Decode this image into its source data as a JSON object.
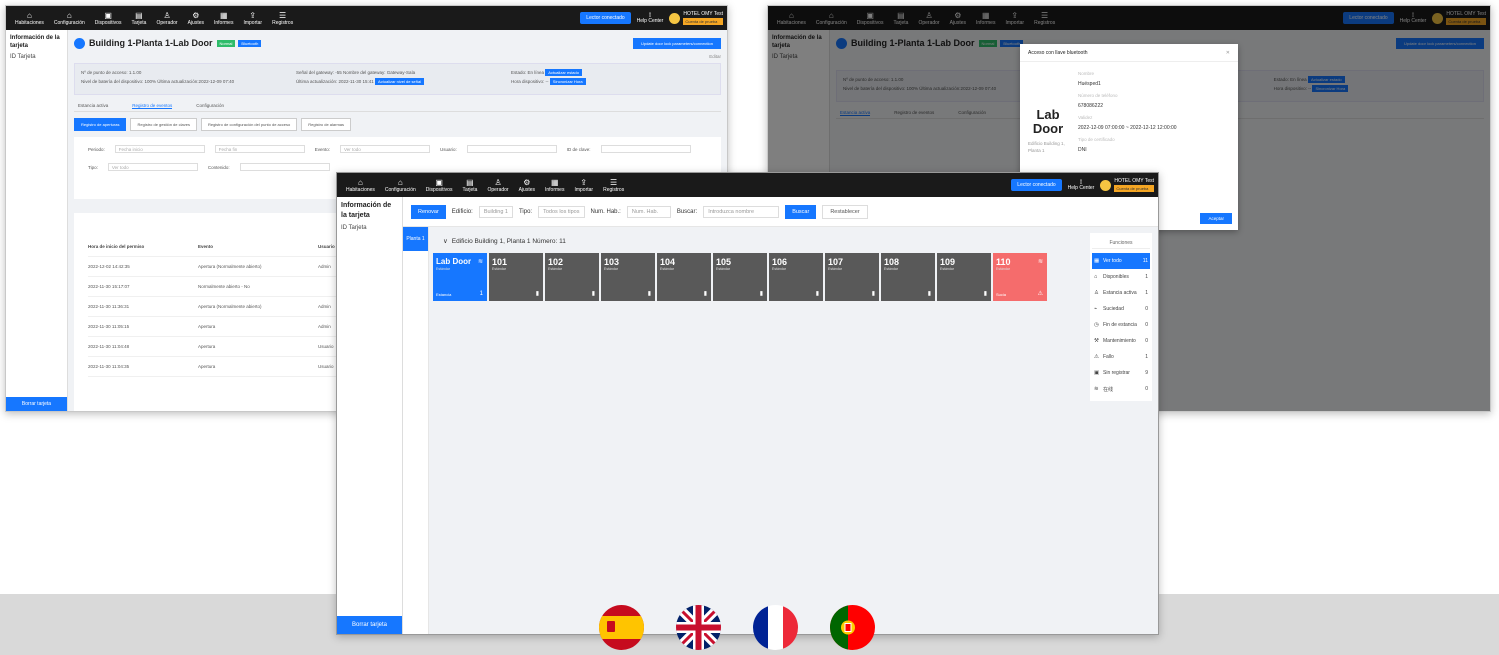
{
  "nav": [
    {
      "icon": "hotel-icon",
      "label": "Habitaciones"
    },
    {
      "icon": "home-icon",
      "label": "Configuración"
    },
    {
      "icon": "device-icon",
      "label": "Dispositivos"
    },
    {
      "icon": "card-icon",
      "label": "Tarjeta"
    },
    {
      "icon": "operator-icon",
      "label": "Operador"
    },
    {
      "icon": "gear-icon",
      "label": "Ajustes"
    },
    {
      "icon": "report-icon",
      "label": "Informes"
    },
    {
      "icon": "import-icon",
      "label": "Importar"
    },
    {
      "icon": "log-icon",
      "label": "Registros"
    }
  ],
  "topbar": {
    "encoder_button": "Lector conectado",
    "help": "Help Center",
    "hotel_name": "HOTEL OMY Test",
    "hotel_tag": "Cuenta de prueba"
  },
  "sidebar": {
    "title": "Información de la tarjeta",
    "item": "ID Tarjeta",
    "bottom_button": "Borrar tarjeta"
  },
  "door_window": {
    "title": "Building 1-Planta 1-Lab Door",
    "tag_status": "Normal",
    "tag_type": "Bluetooth",
    "right_button": "Update door lock parameters/connection",
    "edit": "Editar",
    "info_col1": [
      "Nº de punto de acceso: 1.1.00",
      "Nivel de batería del dispositivo: 100%   Última actualización:2022-12-09 07:40"
    ],
    "info_col2": [
      "Señal del gateway: -55   Nombre del gateway: Gateway-Sala",
      "Última actualización: 2022-11-30 15:41"
    ],
    "info_col2_btn": "Actualizar nivel de señal",
    "info_col3": [
      "Estado: En línea",
      "Hora dispositivo: --"
    ],
    "info_col3_btn1": "Actualizar estado",
    "info_col3_btn2": "Sincronizar Hora",
    "tabs": [
      "Estancia activa",
      "Registro de eventos",
      "Configuración"
    ],
    "sub_tabs": [
      "Registro de aperturas",
      "Registro de gestión de claves",
      "Registro de configuración del punto de acceso",
      "Registro de alarmas"
    ],
    "filter_labels": [
      "Periodo:",
      "Evento:",
      "Usuario:",
      "ID de clave:",
      "Tipo:",
      "Contenido:"
    ],
    "filter_placeholders": [
      "Fecha inicio",
      "Fecha fin",
      "Ver todo",
      "Ver todo"
    ],
    "table_headers": [
      "Hora de inicio del permiso",
      "Evento",
      "Usuario"
    ],
    "table_rows": [
      [
        "2022-12-02 14:42:35",
        "Apertura (Normalmente abierto)",
        "Admin"
      ],
      [
        "2022-11-30 15:17:07",
        "Normalmente abierto - No",
        ""
      ],
      [
        "2022-11-30 11:36:31",
        "Apertura (Normalmente abierto)",
        "Admin"
      ],
      [
        "2022-11-30 11:05:15",
        "Apertura",
        "Admin"
      ],
      [
        "2022-11-30 11:04:48",
        "Apertura",
        "Usuario"
      ],
      [
        "2022-11-30 11:04:35",
        "Apertura",
        "Usuario"
      ]
    ]
  },
  "modal": {
    "title": "Acceso con llave bluetooth",
    "door_name_1": "Lab",
    "door_name_2": "Door",
    "door_sub": "Edificio Building 1, Planta 1",
    "fields": [
      {
        "label": "Nombre",
        "value": "Huésped1"
      },
      {
        "label": "Número de teléfono",
        "value": "678086222"
      },
      {
        "label": "Validez",
        "value": "2022-12-09 07:00:00 ~ 2022-12-12 12:00:00"
      },
      {
        "label": "Tipo de certificado",
        "value": "DNI"
      }
    ],
    "ok": "Aceptar"
  },
  "rooms_window": {
    "toolbar": {
      "refresh": "Renovar",
      "building_label": "Edificio:",
      "building_value": "Building 1",
      "type_label": "Tipo:",
      "type_value": "Todos los tipos",
      "room_label": "Num. Hab.:",
      "room_placeholder": "Num. Hab.",
      "search_label": "Buscar:",
      "search_placeholder": "Introduzca nombre",
      "search_btn": "Buscar",
      "reset_btn": "Restablecer"
    },
    "floor": "Planta 1",
    "building_line": "Edificio Building 1, Planta 1   Número: 11",
    "rooms": [
      {
        "num": "Lab Door",
        "sub": "Estándar",
        "style": "blue",
        "bottom": "Estancia",
        "count": "1"
      },
      {
        "num": "101",
        "sub": "Estándar",
        "style": "grey"
      },
      {
        "num": "102",
        "sub": "Estándar",
        "style": "grey"
      },
      {
        "num": "103",
        "sub": "Estándar",
        "style": "grey"
      },
      {
        "num": "104",
        "sub": "Estándar",
        "style": "grey"
      },
      {
        "num": "105",
        "sub": "Estándar",
        "style": "grey"
      },
      {
        "num": "106",
        "sub": "Estándar",
        "style": "grey"
      },
      {
        "num": "107",
        "sub": "Estándar",
        "style": "grey"
      },
      {
        "num": "108",
        "sub": "Estándar",
        "style": "grey"
      },
      {
        "num": "109",
        "sub": "Estándar",
        "style": "grey"
      },
      {
        "num": "110",
        "sub": "Estándar",
        "style": "red",
        "bottom": "Sucia"
      }
    ],
    "func_title": "Funciones",
    "functions": [
      {
        "icon": "grid-icon",
        "label": "Ver todo",
        "count": "11",
        "active": true
      },
      {
        "icon": "home-icon",
        "label": "Disponibles",
        "count": "1"
      },
      {
        "icon": "person-icon",
        "label": "Estancia activa",
        "count": "1"
      },
      {
        "icon": "broom-icon",
        "label": "Suciedad",
        "count": "0"
      },
      {
        "icon": "clock-icon",
        "label": "Fin de estancia",
        "count": "0"
      },
      {
        "icon": "wrench-icon",
        "label": "Mantenimiento",
        "count": "0"
      },
      {
        "icon": "warning-icon",
        "label": "Fallo",
        "count": "1"
      },
      {
        "icon": "lock-icon",
        "label": "Sin registrar",
        "count": "9"
      },
      {
        "icon": "wifi-icon",
        "label": "在线",
        "count": "0"
      }
    ]
  },
  "flags": [
    "spain-flag",
    "uk-flag",
    "france-flag",
    "portugal-flag"
  ]
}
